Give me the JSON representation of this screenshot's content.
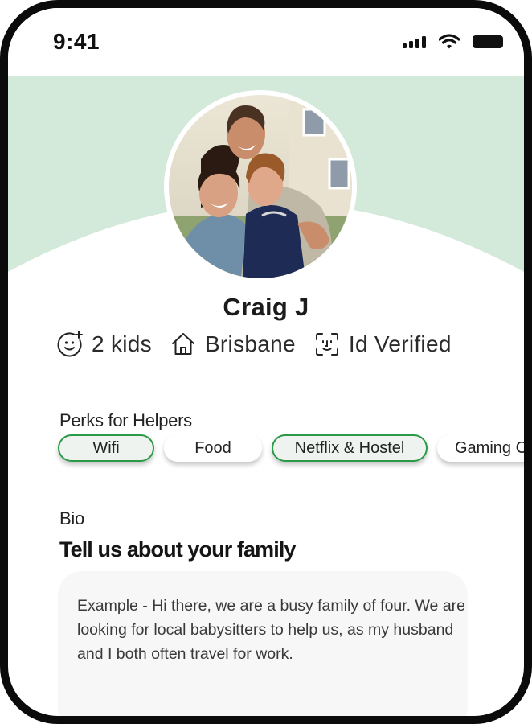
{
  "status_bar": {
    "time": "9:41"
  },
  "profile": {
    "name": "Craig J",
    "kids": "2 kids",
    "location": "Brisbane",
    "verification": "Id Verified"
  },
  "perks": {
    "label": "Perks for Helpers",
    "items": [
      {
        "label": "Wifi",
        "selected": true
      },
      {
        "label": "Food",
        "selected": false
      },
      {
        "label": "Netflix & Hostel",
        "selected": true
      },
      {
        "label": "Gaming C",
        "selected": false
      }
    ]
  },
  "bio": {
    "label": "Bio",
    "heading": "Tell us about your family",
    "text": "Example - Hi there, we are a busy family of four. We are looking for local babysitters to help us, as my husband and I both often travel for work."
  },
  "colors": {
    "hero_background": "#d3e9d9",
    "chip_selected_border": "#2a9a45",
    "bio_box_background": "#f7f7f7"
  }
}
